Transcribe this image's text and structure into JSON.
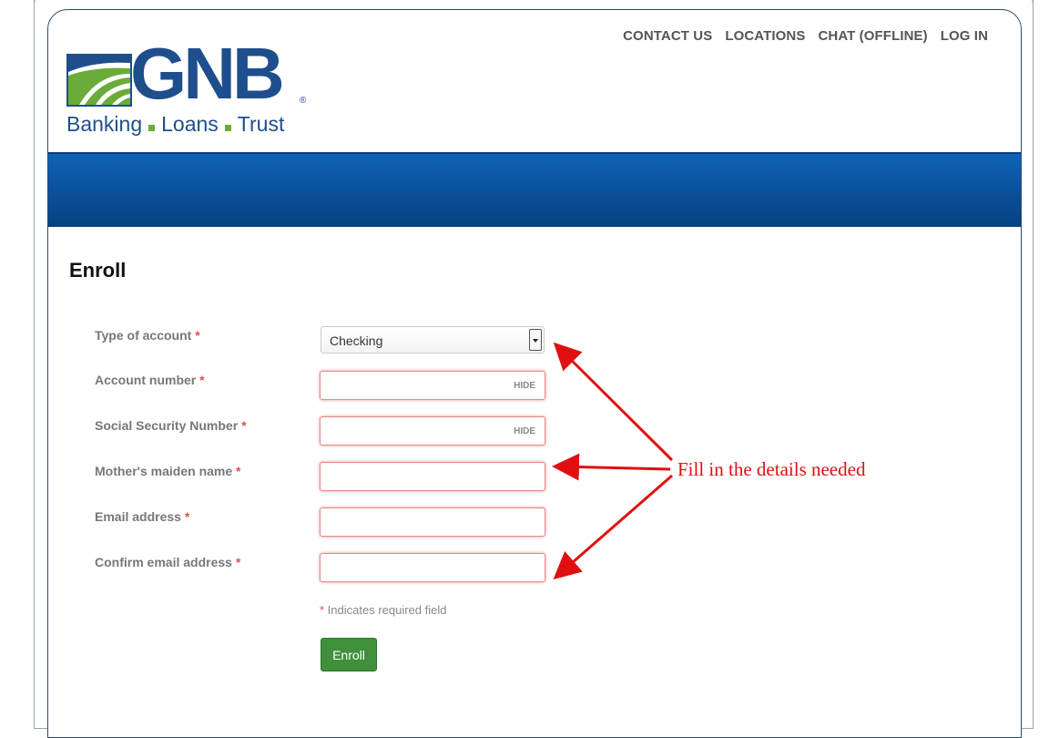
{
  "nav": {
    "contact": "CONTACT US",
    "locations": "LOCATIONS",
    "chat": "CHAT (OFFLINE)",
    "login": "LOG IN"
  },
  "logo": {
    "name": "GNB",
    "tagline": [
      "Banking",
      "Loans",
      "Trust"
    ],
    "registered": "®"
  },
  "page": {
    "title": "Enroll"
  },
  "form": {
    "fields": [
      {
        "label": "Type of account",
        "required": "*",
        "value": "Checking"
      },
      {
        "label": "Account number",
        "required": "*",
        "toggle": "HIDE"
      },
      {
        "label": "Social Security Number",
        "required": "*",
        "toggle": "HIDE"
      },
      {
        "label": "Mother's maiden name",
        "required": "*"
      },
      {
        "label": "Email address",
        "required": "*"
      },
      {
        "label": "Confirm email address",
        "required": "*"
      }
    ],
    "required_note": {
      "star": "*",
      "text": " Indicates required field"
    },
    "submit_label": "Enroll"
  },
  "annotation": {
    "text": "Fill in the details needed"
  },
  "colors": {
    "brand_blue": "#1f4e8c",
    "brand_green": "#6aab3a",
    "band_blue": "#0a4e98",
    "submit_green": "#3f8f3b",
    "annotation_red": "#e01010"
  }
}
